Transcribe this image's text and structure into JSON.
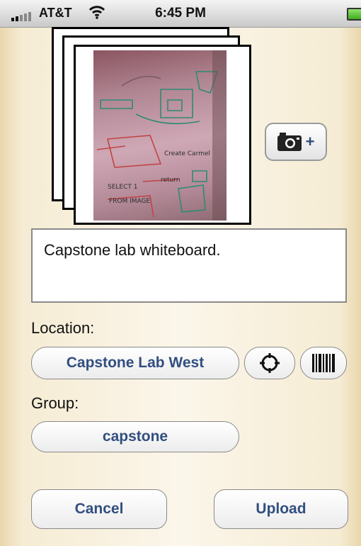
{
  "status_bar": {
    "carrier": "AT&T",
    "time": "6:45 PM",
    "signal_icon": "signal-strength-icon",
    "wifi_icon": "wifi-icon",
    "battery_icon": "battery-icon",
    "battery_color": "#3fae1f"
  },
  "photo": {
    "icon": "whiteboard-photo-stack"
  },
  "camera_button": {
    "icon": "camera-icon",
    "plus": "+"
  },
  "caption": {
    "value": "Capstone lab whiteboard."
  },
  "location": {
    "label": "Location:",
    "value": "Capstone Lab West",
    "locate_icon": "crosshair-icon",
    "barcode_icon": "barcode-icon"
  },
  "group": {
    "label": "Group:",
    "value": "capstone"
  },
  "actions": {
    "cancel": "Cancel",
    "upload": "Upload"
  },
  "colors": {
    "button_text": "#324f80",
    "background": "#fbf6ea"
  }
}
